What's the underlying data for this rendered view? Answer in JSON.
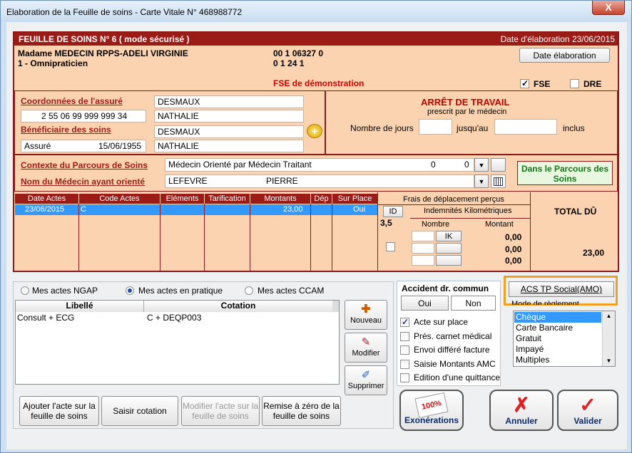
{
  "window": {
    "title": "Elaboration de la Feuille de soins - Carte Vitale N° 468988772",
    "close": "X"
  },
  "header": {
    "title": "FEUILLE DE SOINS  N° 6 ( mode sécurisé )",
    "date_label": "Date d'élaboration 23/06/2015"
  },
  "doctor": {
    "name": "Madame MEDECIN RPPS-ADELI VIRGINIE",
    "specialty": "1 - Omnipraticien",
    "code1": "00 1 06327 0",
    "code2": "0 1 24 1",
    "demo": "FSE de démonstration"
  },
  "date_button": "Date élaboration",
  "fse": {
    "label": "FSE",
    "checked": true
  },
  "dre": {
    "label": "DRE",
    "checked": false
  },
  "insured": {
    "section_label": "Coordonnées de l'assuré",
    "number": "2 55 06 99 999 999 34",
    "last_name": "DESMAUX",
    "first_name": "NATHALIE"
  },
  "beneficiary": {
    "section_label": "Bénéficiaire des soins",
    "status": "Assuré",
    "birth": "15/06/1955",
    "last_name": "DESMAUX",
    "first_name": "NATHALIE"
  },
  "work_stop": {
    "title": "ARRÊT DE TRAVAIL",
    "subtitle": "prescrit par le médecin",
    "days_label": "Nombre de jours",
    "until_label": "jusqu'au",
    "included_label": "inclus"
  },
  "parcours": {
    "label": "Contexte du Parcours de Soins",
    "value": "Médecin Orienté par Médecin Traitant",
    "v1": "0",
    "v2": "0"
  },
  "referring": {
    "label": "Nom du Médecin ayant orienté",
    "last_name": "LEFEVRE",
    "first_name": "PIERRE"
  },
  "parcours_badge": "Dans le Parcours des Soins",
  "acts_table": {
    "headers": [
      "Date Actes",
      "Code Actes",
      "Eléments",
      "Tarification",
      "Montants",
      "Dép",
      "Sur Place"
    ],
    "rows": [
      [
        "23/06/2015",
        "C",
        "",
        "",
        "23,00",
        "",
        "Oui"
      ]
    ]
  },
  "travel": {
    "title": "Frais de déplacement perçus",
    "id_btn": "ID",
    "ik_label": "Indemnités Kilométriques",
    "value": "3,5",
    "nombre": "Nombre",
    "montant": "Montant",
    "ik_btn": "IK",
    "amounts": [
      "0,00",
      "0,00",
      "0,00"
    ]
  },
  "total": {
    "label": "TOTAL DÛ",
    "value": "23,00"
  },
  "acts_filter": {
    "options": [
      "Mes actes NGAP",
      "Mes actes en pratique",
      "Mes actes CCAM"
    ],
    "selected": "Mes actes en pratique"
  },
  "acts_list": {
    "headers": [
      "Libellé",
      "Cotation"
    ],
    "rows": [
      [
        "Consult + ECG",
        "C + DEQP003"
      ]
    ]
  },
  "side_buttons": {
    "new": "Nouveau",
    "edit": "Modifier",
    "delete": "Supprimer"
  },
  "bottom_buttons": {
    "add": "Ajouter l'acte sur la feuille de soins",
    "enter": "Saisir cotation",
    "modify": "Modifier l'acte sur la feuille de soins",
    "reset": "Remise à zéro de la feuille de soins"
  },
  "accident": {
    "title": "Accident dr. commun",
    "yes": "Oui",
    "no": "Non"
  },
  "options": [
    {
      "label": "Acte sur place",
      "checked": true
    },
    {
      "label": "Prés. carnet médical",
      "checked": false
    },
    {
      "label": "Envoi différé facture",
      "checked": false
    },
    {
      "label": "Saisie Montants AMC",
      "checked": false
    },
    {
      "label": "Edition d'une quittance",
      "checked": false
    }
  ],
  "acs_button": "ACS TP Social(AMO)",
  "payment": {
    "label": "Mode de règlement",
    "items": [
      "Chèque",
      "Carte Bancaire",
      "Gratuit",
      "Impayé",
      "Multiples"
    ],
    "selected": "Chèque"
  },
  "actions": {
    "exemptions": "Exonérations",
    "cancel": "Annuler",
    "validate": "Valider",
    "stamp": "100%"
  },
  "colors": {
    "accent": "#9b1b16",
    "panel": "#fbd3b0",
    "highlight": "#f0a022",
    "selection": "#3399ff"
  }
}
